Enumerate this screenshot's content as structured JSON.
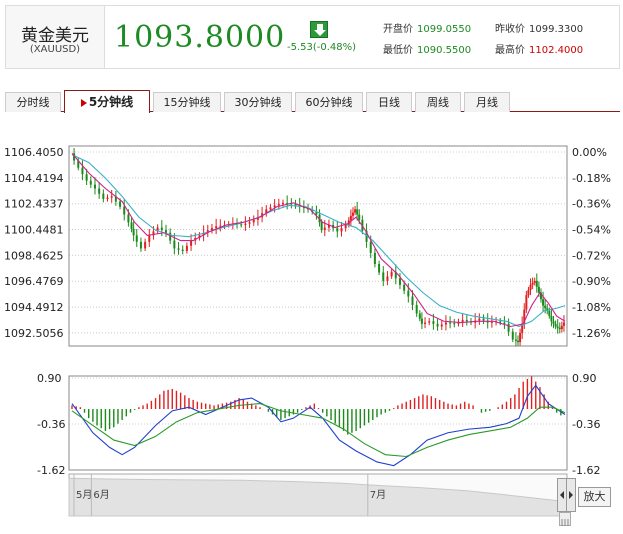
{
  "header": {
    "name": "黄金美元",
    "code": "(XAUUSD)",
    "price": "1093.8000",
    "change": "-5.53(-0.48%)",
    "stats": [
      {
        "label": "开盘价",
        "value": "1099.0550",
        "color": "#1e8a24"
      },
      {
        "label": "昨收价",
        "value": "1099.3300",
        "color": "#333333"
      },
      {
        "label": "最低价",
        "value": "1090.5500",
        "color": "#1e8a24"
      },
      {
        "label": "最高价",
        "value": "1102.4000",
        "color": "#cc0000"
      }
    ]
  },
  "tabs": [
    "分时线",
    "5分钟线",
    "15分钟线",
    "30分钟线",
    "60分钟线",
    "日线",
    "周线",
    "月线"
  ],
  "active_tab": 1,
  "zoom_label": "放大",
  "colors": {
    "up": "#e02020",
    "down": "#1a8a1a",
    "ma_blue": "#3ab0c8",
    "ma_pink": "#d0208a",
    "macd_blue": "#1f3fd0",
    "macd_green": "#2a9a2a",
    "frame": "#888888",
    "grid": "#cccccc"
  },
  "chart_data": [
    {
      "type": "candlestick",
      "y_ticks": [
        "1106.4050",
        "1104.4194",
        "1102.4337",
        "1100.4481",
        "1098.4625",
        "1096.4769",
        "1094.4912",
        "1092.5056"
      ],
      "y_values": [
        1106.405,
        1104.4194,
        1102.4337,
        1100.4481,
        1098.4625,
        1096.4769,
        1094.4912,
        1092.5056
      ],
      "right_ticks": [
        "0.00%",
        "-0.18%",
        "-0.36%",
        "-0.54%",
        "-0.72%",
        "-0.90%",
        "-1.08%",
        "-1.26%"
      ],
      "ylim": [
        1091.5,
        1106.405
      ],
      "price_path": [
        [
          0,
          1106.3
        ],
        [
          4,
          1105.2
        ],
        [
          8,
          1104.2
        ],
        [
          12,
          1103.6
        ],
        [
          16,
          1102.8
        ],
        [
          20,
          1103.0
        ],
        [
          24,
          1102.2
        ],
        [
          28,
          1101.0
        ],
        [
          30,
          1100.0
        ],
        [
          34,
          1099.0
        ],
        [
          38,
          1100.0
        ],
        [
          42,
          1100.6
        ],
        [
          46,
          1100.2
        ],
        [
          50,
          1099.0
        ],
        [
          54,
          1098.8
        ],
        [
          58,
          1099.6
        ],
        [
          62,
          1100.0
        ],
        [
          66,
          1100.4
        ],
        [
          70,
          1100.7
        ],
        [
          74,
          1100.8
        ],
        [
          78,
          1100.9
        ],
        [
          82,
          1100.8
        ],
        [
          86,
          1101.0
        ],
        [
          90,
          1101.4
        ],
        [
          94,
          1102.0
        ],
        [
          98,
          1102.3
        ],
        [
          102,
          1102.5
        ],
        [
          106,
          1102.4
        ],
        [
          110,
          1102.2
        ],
        [
          114,
          1102.0
        ],
        [
          118,
          1101.6
        ],
        [
          120,
          1100.4
        ],
        [
          124,
          1100.8
        ],
        [
          128,
          1100.3
        ],
        [
          132,
          1100.8
        ],
        [
          134,
          1101.5
        ],
        [
          136,
          1102.0
        ],
        [
          138,
          1101.2
        ],
        [
          142,
          1099.5
        ],
        [
          146,
          1097.8
        ],
        [
          150,
          1096.5
        ],
        [
          154,
          1097.2
        ],
        [
          158,
          1096.2
        ],
        [
          162,
          1095.3
        ],
        [
          166,
          1094.0
        ],
        [
          168,
          1093.2
        ],
        [
          172,
          1093.4
        ],
        [
          176,
          1093.0
        ],
        [
          180,
          1093.3
        ],
        [
          184,
          1093.2
        ],
        [
          188,
          1093.5
        ],
        [
          192,
          1093.3
        ],
        [
          196,
          1093.6
        ],
        [
          200,
          1093.3
        ],
        [
          204,
          1093.4
        ],
        [
          208,
          1093.2
        ],
        [
          212,
          1092.0
        ],
        [
          214,
          1091.8
        ],
        [
          216,
          1093.2
        ],
        [
          218,
          1095.4
        ],
        [
          220,
          1096.2
        ],
        [
          222,
          1096.5
        ],
        [
          224,
          1095.6
        ],
        [
          226,
          1094.6
        ],
        [
          228,
          1094.2
        ],
        [
          230,
          1093.4
        ],
        [
          232,
          1093.0
        ],
        [
          234,
          1092.8
        ],
        [
          236,
          1093.3
        ]
      ],
      "ma_blue": [
        [
          0,
          1106.2
        ],
        [
          8,
          1105.6
        ],
        [
          16,
          1104.4
        ],
        [
          24,
          1103.0
        ],
        [
          32,
          1101.4
        ],
        [
          40,
          1100.4
        ],
        [
          48,
          1100.0
        ],
        [
          56,
          1099.9
        ],
        [
          64,
          1100.2
        ],
        [
          72,
          1100.6
        ],
        [
          80,
          1100.9
        ],
        [
          88,
          1101.3
        ],
        [
          96,
          1101.9
        ],
        [
          104,
          1102.3
        ],
        [
          112,
          1102.2
        ],
        [
          120,
          1101.6
        ],
        [
          128,
          1101.0
        ],
        [
          136,
          1100.6
        ],
        [
          144,
          1099.6
        ],
        [
          152,
          1098.2
        ],
        [
          160,
          1096.8
        ],
        [
          168,
          1095.6
        ],
        [
          176,
          1094.6
        ],
        [
          184,
          1094.1
        ],
        [
          192,
          1093.8
        ],
        [
          200,
          1093.6
        ],
        [
          208,
          1093.4
        ],
        [
          214,
          1093.0
        ],
        [
          220,
          1093.4
        ],
        [
          226,
          1094.2
        ],
        [
          232,
          1094.4
        ],
        [
          236,
          1094.6
        ]
      ],
      "ma_pink": [
        [
          0,
          1106.3
        ],
        [
          8,
          1104.8
        ],
        [
          16,
          1103.6
        ],
        [
          24,
          1102.6
        ],
        [
          30,
          1101.0
        ],
        [
          36,
          1100.0
        ],
        [
          44,
          1100.2
        ],
        [
          52,
          1099.6
        ],
        [
          58,
          1099.6
        ],
        [
          66,
          1100.3
        ],
        [
          74,
          1100.8
        ],
        [
          82,
          1101.0
        ],
        [
          90,
          1101.4
        ],
        [
          98,
          1102.2
        ],
        [
          106,
          1102.5
        ],
        [
          114,
          1102.0
        ],
        [
          120,
          1101.0
        ],
        [
          126,
          1100.6
        ],
        [
          132,
          1100.9
        ],
        [
          136,
          1101.4
        ],
        [
          140,
          1100.5
        ],
        [
          148,
          1098.2
        ],
        [
          156,
          1097.0
        ],
        [
          164,
          1095.4
        ],
        [
          170,
          1094.0
        ],
        [
          178,
          1093.4
        ],
        [
          186,
          1093.3
        ],
        [
          194,
          1093.4
        ],
        [
          202,
          1093.4
        ],
        [
          210,
          1093.0
        ],
        [
          216,
          1093.2
        ],
        [
          220,
          1094.6
        ],
        [
          224,
          1095.6
        ],
        [
          228,
          1094.8
        ],
        [
          232,
          1093.8
        ],
        [
          236,
          1093.4
        ]
      ]
    },
    {
      "type": "macd",
      "y_ticks": [
        "0.90",
        "-0.36",
        "-1.62"
      ],
      "y_values": [
        0.9,
        -0.36,
        -1.62
      ],
      "ylim": [
        -1.62,
        0.9
      ],
      "hist": [
        [
          0,
          0.1
        ],
        [
          4,
          0.05
        ],
        [
          8,
          -0.25
        ],
        [
          12,
          -0.45
        ],
        [
          16,
          -0.6
        ],
        [
          20,
          -0.5
        ],
        [
          24,
          -0.3
        ],
        [
          28,
          -0.1
        ],
        [
          32,
          0.05
        ],
        [
          36,
          0.15
        ],
        [
          40,
          0.3
        ],
        [
          44,
          0.5
        ],
        [
          48,
          0.55
        ],
        [
          52,
          0.45
        ],
        [
          56,
          0.3
        ],
        [
          60,
          0.2
        ],
        [
          64,
          0.15
        ],
        [
          68,
          0.1
        ],
        [
          72,
          0.15
        ],
        [
          76,
          0.2
        ],
        [
          80,
          0.3
        ],
        [
          84,
          0.2
        ],
        [
          88,
          0.1
        ],
        [
          92,
          0.0
        ],
        [
          96,
          -0.15
        ],
        [
          100,
          -0.3
        ],
        [
          104,
          -0.2
        ],
        [
          108,
          -0.1
        ],
        [
          112,
          0.05
        ],
        [
          116,
          0.15
        ],
        [
          120,
          -0.1
        ],
        [
          124,
          -0.3
        ],
        [
          128,
          -0.5
        ],
        [
          132,
          -0.7
        ],
        [
          136,
          -0.6
        ],
        [
          140,
          -0.45
        ],
        [
          144,
          -0.3
        ],
        [
          148,
          -0.15
        ],
        [
          152,
          -0.05
        ],
        [
          156,
          0.1
        ],
        [
          160,
          0.2
        ],
        [
          164,
          0.3
        ],
        [
          168,
          0.4
        ],
        [
          172,
          0.35
        ],
        [
          176,
          0.25
        ],
        [
          180,
          0.15
        ],
        [
          184,
          0.1
        ],
        [
          188,
          0.2
        ],
        [
          192,
          0.1
        ],
        [
          196,
          -0.1
        ],
        [
          200,
          -0.05
        ],
        [
          204,
          0.05
        ],
        [
          208,
          0.2
        ],
        [
          212,
          0.4
        ],
        [
          216,
          0.75
        ],
        [
          220,
          0.9
        ],
        [
          224,
          0.6
        ],
        [
          228,
          0.2
        ],
        [
          232,
          -0.1
        ],
        [
          236,
          -0.25
        ]
      ],
      "dif": [
        [
          0,
          0.2
        ],
        [
          10,
          -0.6
        ],
        [
          18,
          -1.0
        ],
        [
          24,
          -1.2
        ],
        [
          30,
          -1.0
        ],
        [
          40,
          -0.4
        ],
        [
          48,
          0.0
        ],
        [
          56,
          0.1
        ],
        [
          64,
          -0.1
        ],
        [
          72,
          0.1
        ],
        [
          80,
          0.3
        ],
        [
          86,
          0.35
        ],
        [
          94,
          0.1
        ],
        [
          100,
          -0.3
        ],
        [
          106,
          -0.2
        ],
        [
          114,
          0.1
        ],
        [
          120,
          -0.2
        ],
        [
          128,
          -0.8
        ],
        [
          136,
          -1.1
        ],
        [
          146,
          -1.4
        ],
        [
          154,
          -1.5
        ],
        [
          162,
          -1.2
        ],
        [
          170,
          -0.8
        ],
        [
          180,
          -0.6
        ],
        [
          190,
          -0.5
        ],
        [
          200,
          -0.45
        ],
        [
          208,
          -0.35
        ],
        [
          214,
          -0.2
        ],
        [
          218,
          0.4
        ],
        [
          222,
          0.7
        ],
        [
          228,
          0.2
        ],
        [
          236,
          -0.1
        ]
      ],
      "dea": [
        [
          0,
          0.0
        ],
        [
          10,
          -0.4
        ],
        [
          20,
          -0.8
        ],
        [
          30,
          -0.95
        ],
        [
          40,
          -0.7
        ],
        [
          50,
          -0.3
        ],
        [
          60,
          -0.05
        ],
        [
          70,
          0.05
        ],
        [
          80,
          0.15
        ],
        [
          90,
          0.2
        ],
        [
          100,
          0.0
        ],
        [
          110,
          -0.1
        ],
        [
          120,
          -0.2
        ],
        [
          130,
          -0.5
        ],
        [
          140,
          -0.9
        ],
        [
          150,
          -1.2
        ],
        [
          160,
          -1.25
        ],
        [
          170,
          -1.0
        ],
        [
          180,
          -0.8
        ],
        [
          190,
          -0.65
        ],
        [
          200,
          -0.55
        ],
        [
          210,
          -0.45
        ],
        [
          218,
          -0.2
        ],
        [
          224,
          0.1
        ],
        [
          230,
          0.1
        ],
        [
          236,
          -0.05
        ]
      ]
    },
    {
      "type": "area",
      "x_labels": [
        {
          "text": "5月",
          "at": 0.01
        },
        {
          "text": "6月",
          "at": 0.045
        },
        {
          "text": "7月",
          "at": 0.6
        }
      ],
      "values": [
        [
          0,
          0.9
        ],
        [
          0.08,
          0.88
        ],
        [
          0.15,
          0.87
        ],
        [
          0.25,
          0.86
        ],
        [
          0.35,
          0.85
        ],
        [
          0.45,
          0.82
        ],
        [
          0.55,
          0.78
        ],
        [
          0.6,
          0.74
        ],
        [
          0.7,
          0.68
        ],
        [
          0.8,
          0.6
        ],
        [
          0.88,
          0.5
        ],
        [
          0.94,
          0.42
        ],
        [
          1.0,
          0.34
        ]
      ]
    }
  ]
}
